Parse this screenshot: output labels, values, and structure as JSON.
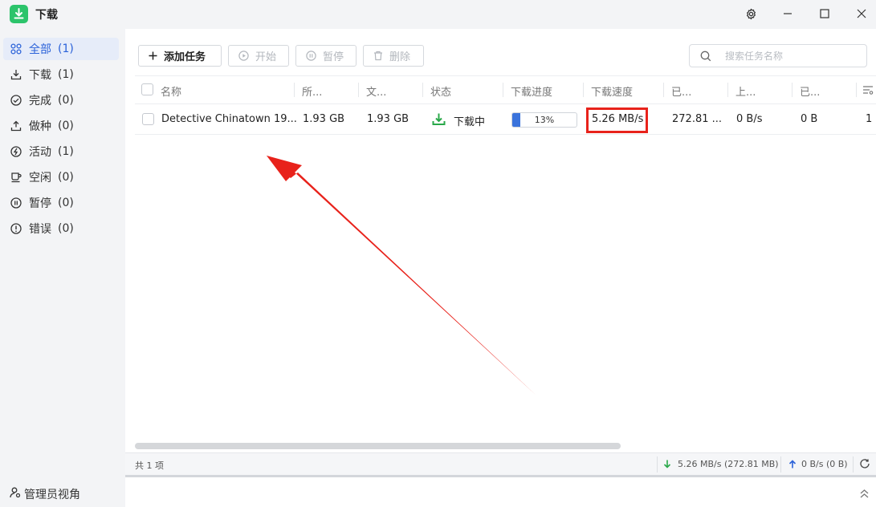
{
  "app": {
    "title": "下载",
    "icon": "download-app-icon"
  },
  "window": {
    "settings_icon": "gear-icon",
    "minimize_icon": "minimize-icon",
    "maximize_icon": "maximize-icon",
    "close_icon": "close-icon"
  },
  "sidebar": {
    "items": [
      {
        "label": "全部",
        "count": "(1)",
        "icon": "grid-icon",
        "active": true
      },
      {
        "label": "下载",
        "count": "(1)",
        "icon": "download-tray-icon"
      },
      {
        "label": "完成",
        "count": "(0)",
        "icon": "check-circle-icon"
      },
      {
        "label": "做种",
        "count": "(0)",
        "icon": "upload-tray-icon"
      },
      {
        "label": "活动",
        "count": "(1)",
        "icon": "activity-icon"
      },
      {
        "label": "空闲",
        "count": "(0)",
        "icon": "cup-icon"
      },
      {
        "label": "暂停",
        "count": "(0)",
        "icon": "pause-circle-icon"
      },
      {
        "label": "错误",
        "count": "(0)",
        "icon": "error-circle-icon"
      }
    ],
    "admin_label": "管理员视角"
  },
  "toolbar": {
    "add_label": "添加任务",
    "start_label": "开始",
    "pause_label": "暂停",
    "delete_label": "删除",
    "search_placeholder": "搜索任务名称"
  },
  "table": {
    "headers": [
      "名称",
      "所...",
      "文...",
      "状态",
      "下载进度",
      "下载速度",
      "已...",
      "上...",
      "已..."
    ],
    "rows": [
      {
        "name": "Detective Chinatown 19...",
        "size": "1.93 GB",
        "file_size": "1.93 GB",
        "status": "下载中",
        "progress": 13,
        "progress_label": "13%",
        "download_speed": "5.26 MB/s",
        "downloaded": "272.81 ...",
        "upload_speed": "0 B/s",
        "uploaded": "0 B",
        "extra": "1"
      }
    ]
  },
  "statusbar": {
    "total": "共 1 项",
    "download_summary": "5.26 MB/s (272.81 MB)",
    "upload_summary": "0 B/s (0 B)"
  },
  "colors": {
    "accent": "#2b62d9",
    "progress": "#3a73dc",
    "highlight": "#e8221b",
    "download_green": "#2aa84a"
  }
}
